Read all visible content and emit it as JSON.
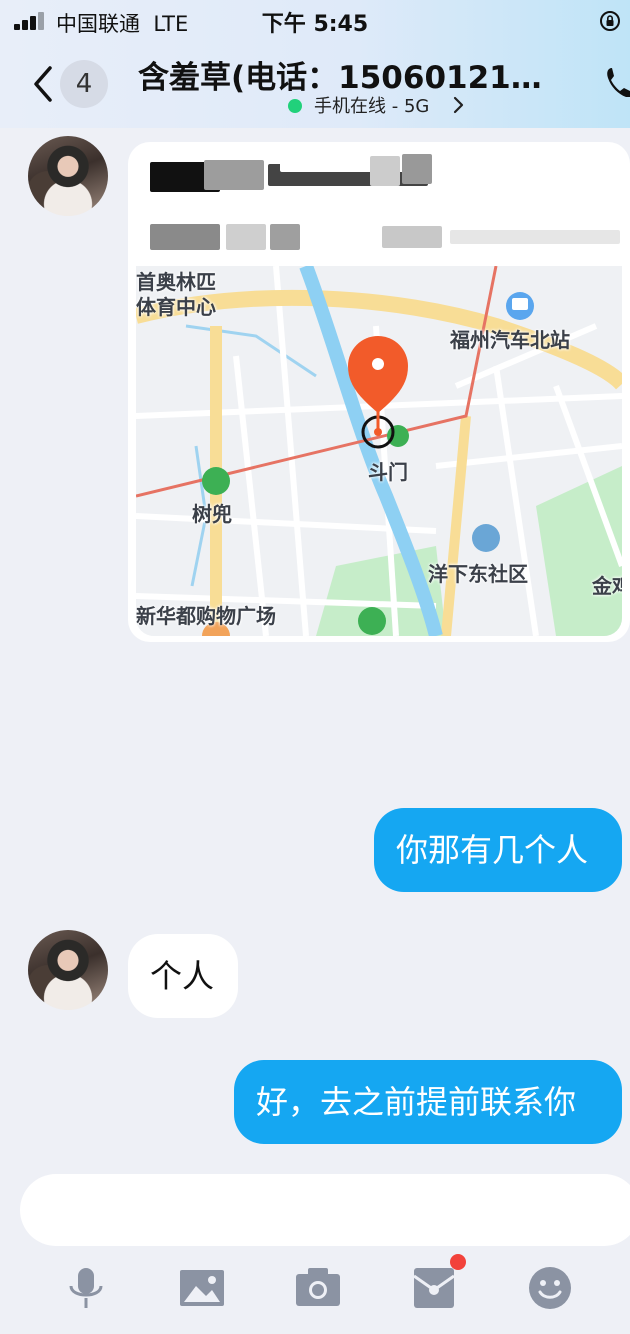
{
  "status_bar": {
    "carrier": "中国联通",
    "network": "LTE",
    "time": "下午 5:45"
  },
  "header": {
    "unread_count": "4",
    "title": "含羞草(电话：150601218…",
    "status": "手机在线 - 5G"
  },
  "messages": [
    {
      "direction": "in",
      "type": "location",
      "map_labels": [
        "首奥林匹",
        "体育中心",
        "福州汽车北站",
        "斗门",
        "树兜",
        "洋下东社区",
        "金鸡",
        "新华都购物广场"
      ]
    },
    {
      "direction": "out",
      "type": "text",
      "text": "你那有几个人"
    },
    {
      "direction": "in",
      "type": "text",
      "text": "个人"
    },
    {
      "direction": "out",
      "type": "text",
      "text": "好，去之前提前联系你"
    }
  ],
  "composer": {
    "input_value": "",
    "tools": [
      "microphone-icon",
      "image-icon",
      "camera-icon",
      "red-envelope-icon",
      "emoji-icon"
    ]
  },
  "colors": {
    "out_bubble": "#15a7f2",
    "online_dot": "#21d17b",
    "badge": "#f2423b",
    "map_pin": "#f25b2a"
  }
}
